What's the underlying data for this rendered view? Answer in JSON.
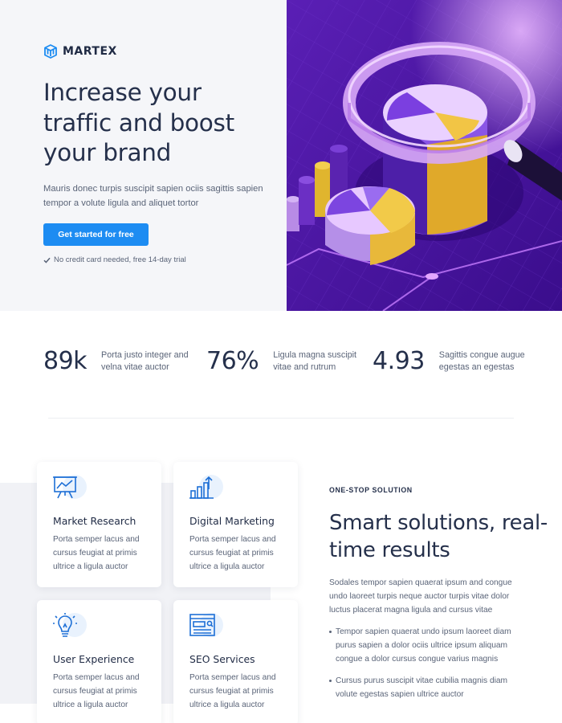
{
  "brand": {
    "name": "MARTEX",
    "logo_icon": "cube-logo-icon",
    "accent": "#1d8cf2"
  },
  "hero": {
    "title": "Increase your traffic and boost your brand",
    "description": "Mauris donec turpis suscipit sapien ociis sagittis sapien tempor a volute ligula and aliquet tortor",
    "cta_label": "Get started for free",
    "cta_note": "No credit card needed, free 14-day trial",
    "illustration": "magnifying-glass-pie-chart-illustration"
  },
  "stats": [
    {
      "value": "89k",
      "text": "Porta justo integer and velna vitae auctor"
    },
    {
      "value": "76%",
      "text": "Ligula magna suscipit vitae and rutrum"
    },
    {
      "value": "4.93",
      "text": "Sagittis congue augue egestas an egestas"
    }
  ],
  "features": [
    {
      "icon": "presentation-chart-icon",
      "title": "Market Research",
      "description": "Porta semper lacus and cursus feugiat at primis ultrice a ligula auctor"
    },
    {
      "icon": "bar-chart-growth-icon",
      "title": "Digital Marketing",
      "description": "Porta semper lacus and cursus feugiat at primis ultrice a ligula auctor"
    },
    {
      "icon": "lightbulb-icon",
      "title": "User Experience",
      "description": "Porta semper lacus and cursus feugiat at primis ultrice a ligula auctor"
    },
    {
      "icon": "seo-browser-icon",
      "title": "SEO Services",
      "description": "Porta semper lacus and cursus feugiat at primis ultrice a ligula auctor"
    }
  ],
  "solutions": {
    "eyebrow": "ONE-STOP SOLUTION",
    "title": "Smart solutions, real-time results",
    "description": "Sodales tempor sapien quaerat ipsum and congue undo laoreet turpis neque auctor turpis vitae dolor luctus placerat magna ligula and cursus vitae",
    "bullets": [
      "Tempor sapien quaerat undo ipsum laoreet diam purus sapien a dolor ociis ultrice ipsum aliquam congue a dolor cursus congue varius magnis",
      "Cursus purus suscipit vitae cubilia magnis diam volute egestas sapien ultrice auctor"
    ]
  }
}
